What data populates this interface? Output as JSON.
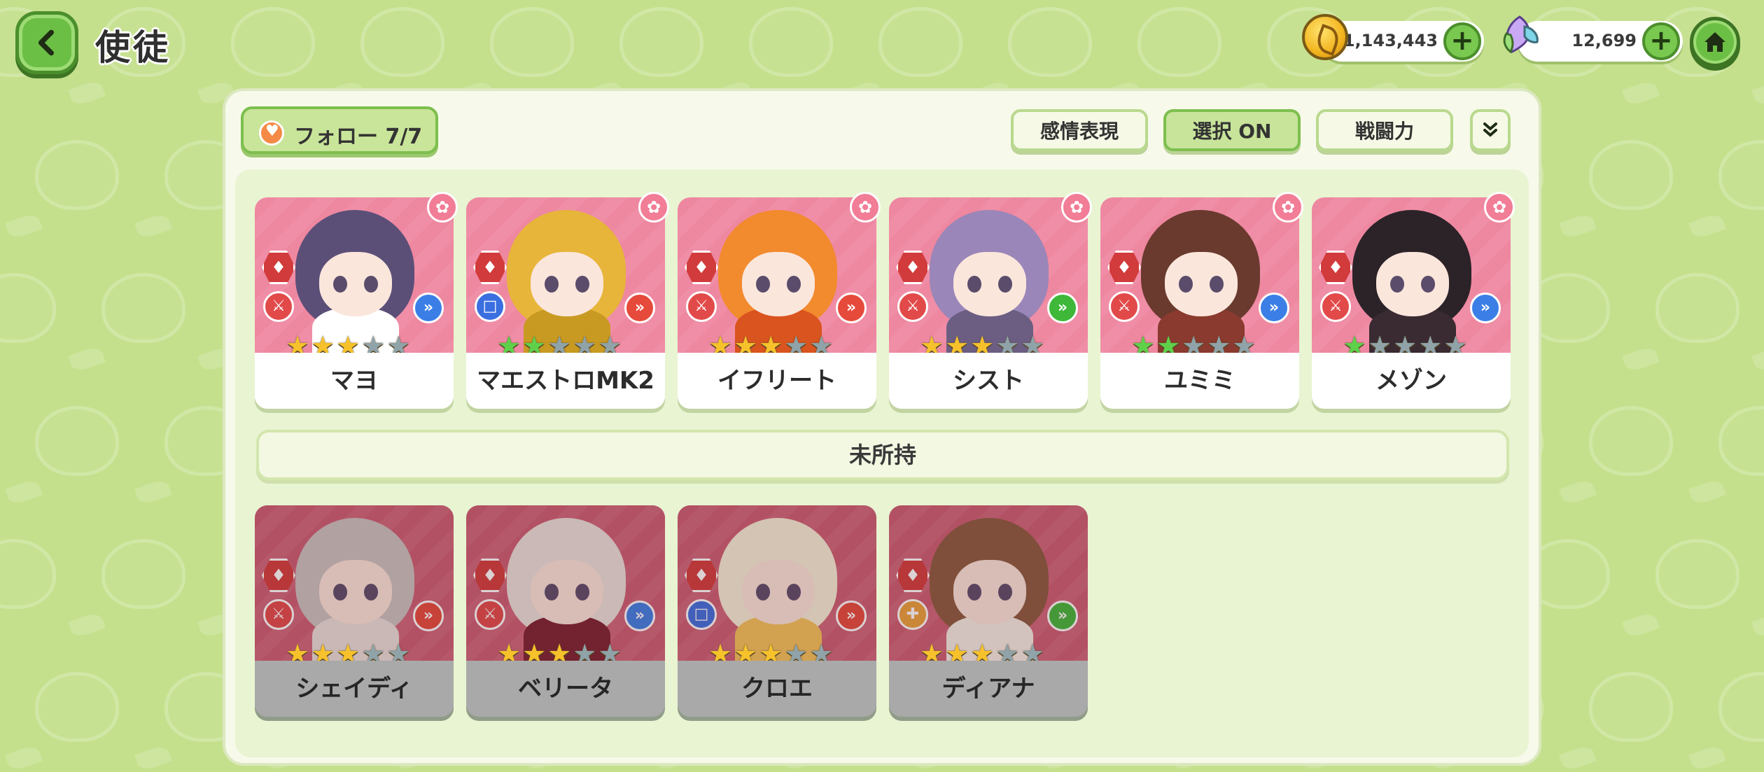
{
  "header": {
    "title": "使徒",
    "gold": "1,143,443",
    "gems": "12,699"
  },
  "toolbar": {
    "follow_label": "フォロー  7/7",
    "emotion_label": "感情表現",
    "select_label": "選択 ON",
    "power_label": "戦闘力"
  },
  "owned": [
    {
      "name": "マヨ",
      "stars": 3,
      "star_color": "gold",
      "element": "fire",
      "role": "attacker",
      "type": "blue"
    },
    {
      "name": "マエストロMK2",
      "stars": 2,
      "star_color": "green",
      "element": "fire",
      "role": "defender",
      "type": "red"
    },
    {
      "name": "イフリート",
      "stars": 3,
      "star_color": "gold",
      "element": "fire",
      "role": "attacker",
      "type": "red"
    },
    {
      "name": "シスト",
      "stars": 3,
      "star_color": "gold",
      "element": "fire",
      "role": "attacker",
      "type": "green"
    },
    {
      "name": "ユミミ",
      "stars": 2,
      "star_color": "green",
      "element": "fire",
      "role": "attacker",
      "type": "blue"
    },
    {
      "name": "メゾン",
      "stars": 1,
      "star_color": "green",
      "element": "fire",
      "role": "attacker",
      "type": "blue"
    }
  ],
  "unowned_header": "未所持",
  "unowned": [
    {
      "name": "シェイディ",
      "stars": 3,
      "star_color": "gold",
      "element": "fire",
      "role": "attacker",
      "type": "red"
    },
    {
      "name": "ベリータ",
      "stars": 3,
      "star_color": "gold",
      "element": "fire",
      "role": "attacker",
      "type": "blue"
    },
    {
      "name": "クロエ",
      "stars": 3,
      "star_color": "gold",
      "element": "fire",
      "role": "defender",
      "type": "red"
    },
    {
      "name": "ディアナ",
      "stars": 3,
      "star_color": "gold",
      "element": "fire",
      "role": "healer",
      "type": "green"
    }
  ],
  "colors": {
    "background": "#c4e08c",
    "card_pink": "#ee87a0",
    "accent_green": "#6cbf45",
    "fire_red": "#d23b3b"
  },
  "icons": {
    "back": "chevron-left-icon",
    "coin": "coin-icon",
    "gem": "gem-icon",
    "home": "home-icon",
    "expand": "double-chevron-down-icon",
    "favorite": "flower-icon"
  }
}
